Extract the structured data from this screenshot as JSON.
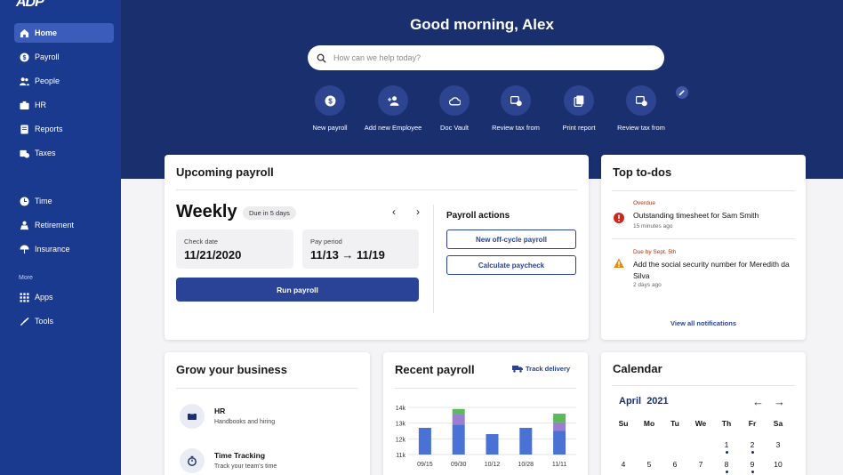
{
  "sidebar": {
    "logo": "ADP",
    "items": [
      {
        "label": "Home",
        "icon": "home-icon",
        "active": true
      },
      {
        "label": "Payroll",
        "icon": "dollar-icon"
      },
      {
        "label": "People",
        "icon": "people-icon"
      },
      {
        "label": "HR",
        "icon": "hr-icon"
      },
      {
        "label": "Reports",
        "icon": "reports-icon"
      },
      {
        "label": "Taxes",
        "icon": "taxes-icon"
      },
      {
        "label": "Time",
        "icon": "clock-icon"
      },
      {
        "label": "Retirement",
        "icon": "retirement-icon"
      },
      {
        "label": "Insurance",
        "icon": "umbrella-icon"
      },
      {
        "label": "Apps",
        "icon": "apps-grid-icon"
      },
      {
        "label": "Tools",
        "icon": "tools-icon"
      }
    ],
    "more_label": "More"
  },
  "header": {
    "greeting": "Good morning, Alex",
    "search_placeholder": "How can we help today?"
  },
  "quick_actions": [
    {
      "label": "New payroll",
      "icon": "dollar-circle-icon"
    },
    {
      "label": "Add new Employee",
      "icon": "add-person-icon"
    },
    {
      "label": "Doc Vault",
      "icon": "cloud-icon"
    },
    {
      "label": "Review tax from",
      "icon": "tax-review-icon"
    },
    {
      "label": "Print report",
      "icon": "document-copy-icon"
    },
    {
      "label": "Review tax from",
      "icon": "tax-review-icon"
    }
  ],
  "upcoming_payroll": {
    "title": "Upcoming payroll",
    "frequency": "Weekly",
    "due": "Due in 5 days",
    "check_date_label": "Check date",
    "check_date": "11/21/2020",
    "pay_period_label": "Pay period",
    "pay_period": "11/13 → 11/19",
    "run_button": "Run payroll",
    "actions_title": "Payroll actions",
    "actions": [
      "New off-cycle payroll",
      "Calculate paycheck"
    ]
  },
  "todos": {
    "title": "Top to-dos",
    "items": [
      {
        "tag": "Overdue",
        "text": "Outstanding timesheet for Sam Smith",
        "time": "15 minutes ago",
        "icon": "error-circle-icon"
      },
      {
        "tag": "Due by Sept. 5th",
        "text": "Add the social security number for Meredith da Silva",
        "time": "2 days ago",
        "icon": "warning-triangle-icon"
      }
    ],
    "view_all": "View all notifications"
  },
  "grow": {
    "title": "Grow your business",
    "items": [
      {
        "title": "HR",
        "subtitle": "Handbooks and hiring",
        "icon": "hr-icon"
      },
      {
        "title": "Time Tracking",
        "subtitle": "Track your team's time",
        "icon": "stopwatch-icon"
      }
    ]
  },
  "recent_payroll": {
    "title": "Recent payroll",
    "track_link": "Track delivery"
  },
  "chart_data": {
    "type": "bar",
    "categories": [
      "09/15",
      "09/30",
      "10/12",
      "10/28",
      "11/11"
    ],
    "ytick_labels": [
      "14k",
      "13k",
      "12k",
      "11k"
    ],
    "ylim": [
      11000,
      14000
    ],
    "series": [
      {
        "color": "#4a72d4",
        "values": [
          12700,
          12900,
          12300,
          12700,
          12500
        ]
      },
      {
        "color": "#9a7fd1",
        "values": [
          0,
          700,
          0,
          0,
          550
        ]
      },
      {
        "color": "#5bb85b",
        "values": [
          0,
          300,
          0,
          0,
          550
        ]
      }
    ]
  },
  "calendar": {
    "title": "Calendar",
    "month": "April",
    "year": "2021",
    "weekdays": [
      "Su",
      "Mo",
      "Tu",
      "We",
      "Th",
      "Fr",
      "Sa"
    ],
    "rows": [
      [
        "",
        "",
        "",
        "",
        "1",
        "2",
        "3"
      ],
      [
        "4",
        "5",
        "6",
        "7",
        "8",
        "9",
        "10"
      ]
    ],
    "dotted_days": [
      "1",
      "2",
      "8",
      "9"
    ]
  }
}
